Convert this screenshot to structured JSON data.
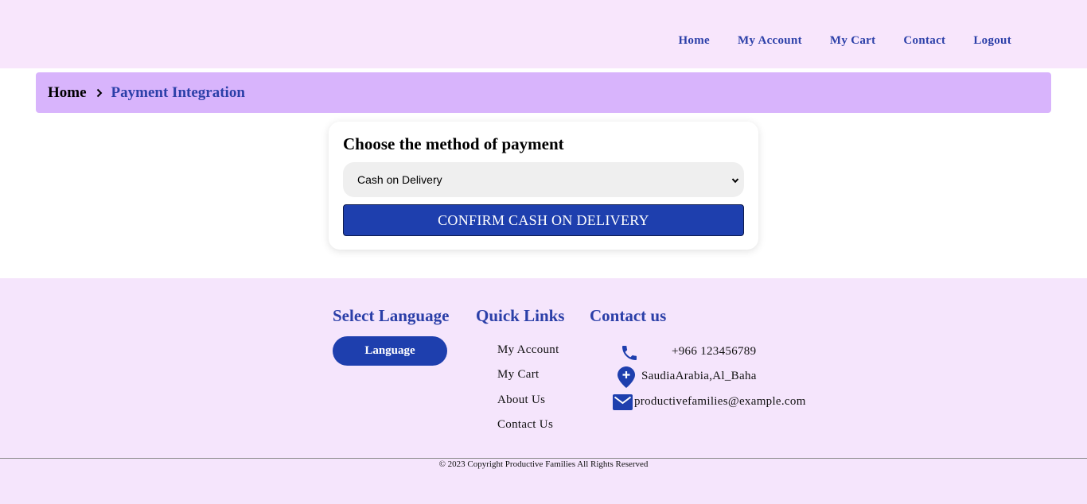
{
  "nav": {
    "items": [
      "Home",
      "My Account",
      "My Cart",
      "Contact",
      "Logout"
    ]
  },
  "breadcrumb": {
    "home": "Home",
    "current": "Payment Integration"
  },
  "payment": {
    "title": "Choose the method of payment",
    "selected_method": "Cash on Delivery",
    "confirm_label": "CONFIRM CASH ON DELIVERY"
  },
  "footer": {
    "language": {
      "title": "Select Language",
      "button": "Language"
    },
    "quick_links": {
      "title": "Quick Links",
      "items": [
        "My Account",
        "My Cart",
        "About Us",
        "Contact Us"
      ]
    },
    "contact": {
      "title": "Contact us",
      "phone": "+966 123456789",
      "address": "SaudiaArabia,Al_Baha",
      "email": "productivefamilies@example.com"
    },
    "copyright": "© 2023 Copyright Productive Families All Rights Reserved"
  },
  "colors": {
    "accent": "#1e3fae",
    "link": "#2b3fa8",
    "header_bg": "#f8e6fc",
    "breadcrumb_bg": "#d8b4fc",
    "footer_bg": "#f5e5fc"
  },
  "icons": [
    "chevron-right-icon",
    "chevron-down-icon",
    "phone-icon",
    "location-icon",
    "mail-icon"
  ]
}
